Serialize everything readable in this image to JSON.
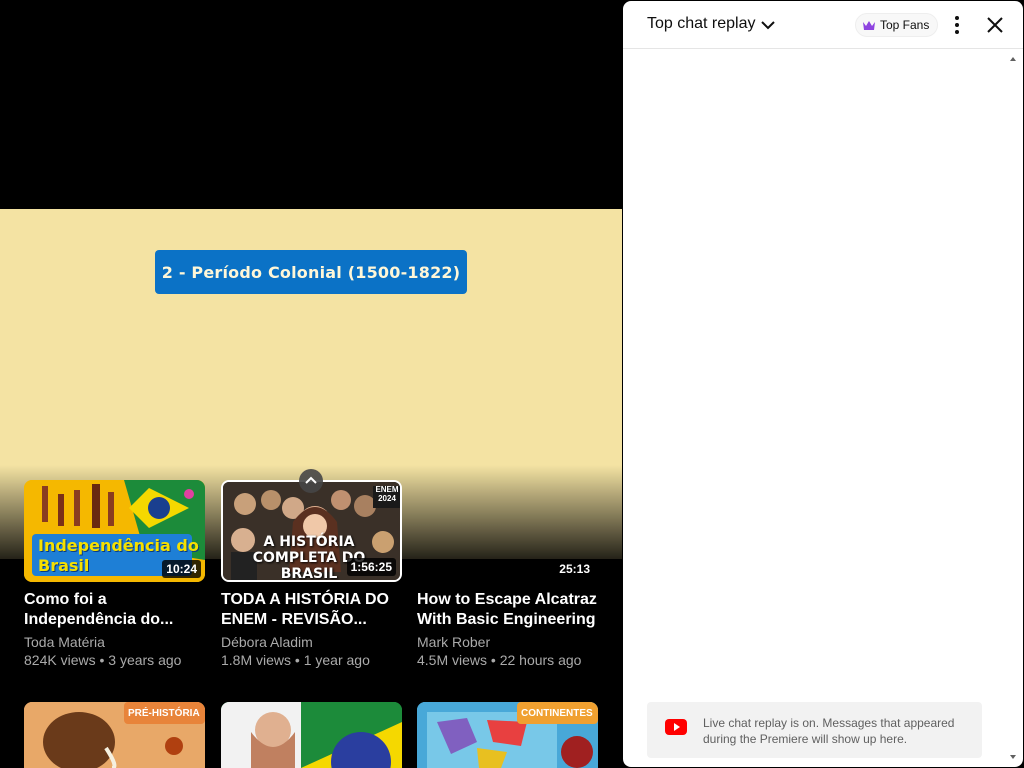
{
  "video": {
    "chapter_label": "2 - Período Colonial (1500-1822)"
  },
  "endscreen": {
    "cards": [
      {
        "title": "Como foi a Independência do...",
        "channel": "Toda Matéria",
        "meta": "824K views • 3 years ago",
        "duration": "10:24",
        "thumb_text": "Independência do Brasil"
      },
      {
        "title": "TODA A HISTÓRIA DO ENEM - REVISÃO...",
        "channel": "Débora Aladim",
        "meta": "1.8M views • 1 year ago",
        "duration": "1:56:25",
        "thumb_text": "A HISTÓRIA COMPLETA DO BRASIL",
        "thumb_badge": "ENEM 2024"
      },
      {
        "title": "How to Escape Alcatraz With Basic Engineering",
        "channel": "Mark Rober",
        "meta": "4.5M views • 22 hours ago",
        "duration": "25:13"
      }
    ],
    "row2": [
      {
        "badge": "PRÉ-HISTÓRIA"
      },
      {
        "badge": ""
      },
      {
        "badge": "CONTINENTES"
      }
    ]
  },
  "chat": {
    "title": "Top chat replay",
    "top_fans_label": "Top Fans",
    "notice": "Live chat replay is on. Messages that appeared during the Premiere will show up here."
  },
  "colors": {
    "accent": "#0b72c6",
    "video_bg": "#f4e3a3",
    "youtube_red": "#ff0000",
    "top_fans_crown": "#8e44e0"
  },
  "icons": [
    "chevron-down-icon",
    "crown-icon",
    "kebab-icon",
    "close-icon",
    "youtube-icon",
    "chevron-up-icon"
  ]
}
